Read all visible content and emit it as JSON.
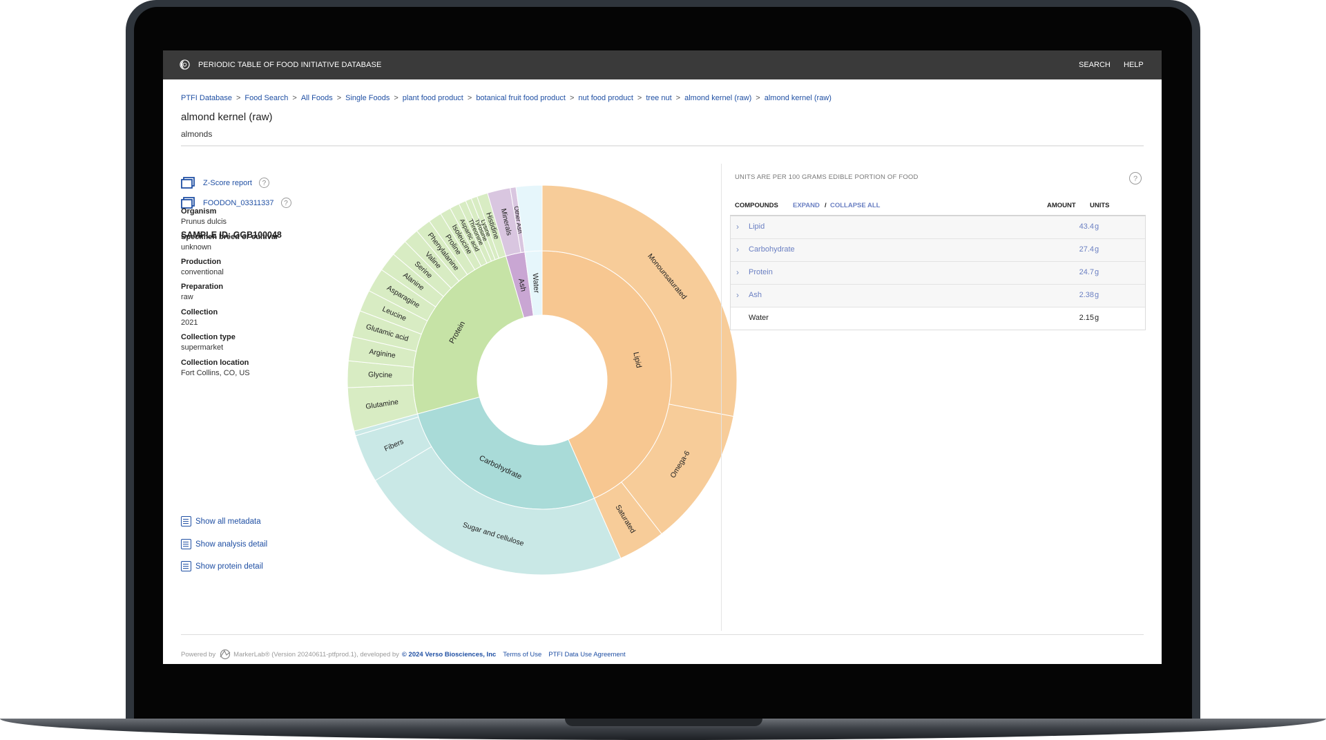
{
  "app": {
    "title": "PERIODIC TABLE OF FOOD INITIATIVE DATABASE"
  },
  "nav": {
    "search": "SEARCH",
    "help": "HELP"
  },
  "breadcrumbs": [
    "PTFI Database",
    "Food Search",
    "All Foods",
    "Single Foods",
    "plant food product",
    "botanical fruit food product",
    "nut food product",
    "tree nut",
    "almond kernel (raw)",
    "almond kernel (raw)"
  ],
  "breadcrumb_separator": ">",
  "food": {
    "title": "almond kernel (raw)",
    "subtitle": "almonds"
  },
  "links": {
    "zscore": "Z-Score report",
    "foodon": "FOODON_03311337"
  },
  "sample": {
    "id_label": "SAMPLE ID: GGB100048",
    "metadata": [
      {
        "key": "Organism",
        "value": "Prunus dulcis"
      },
      {
        "key": "Specimen breed or cultivar",
        "value": "unknown"
      },
      {
        "key": "Production",
        "value": "conventional"
      },
      {
        "key": "Preparation",
        "value": "raw"
      },
      {
        "key": "Collection",
        "value": "2021"
      },
      {
        "key": "Collection type",
        "value": "supermarket"
      },
      {
        "key": "Collection location",
        "value": "Fort Collins, CO, US"
      }
    ]
  },
  "detail_links": {
    "metadata": "Show all metadata",
    "analysis": "Show analysis detail",
    "protein": "Show protein detail"
  },
  "table": {
    "units_note": "UNITS ARE PER 100 GRAMS EDIBLE PORTION OF FOOD",
    "help": "?",
    "compounds_header": "COMPOUNDS",
    "expand": "EXPAND",
    "slash": "/",
    "collapse": "COLLAPSE ALL",
    "amount_header": "AMOUNT",
    "units_header": "UNITS",
    "rows": [
      {
        "name": "Lipid",
        "amount": "43.4",
        "unit": "g",
        "chevron": "›"
      },
      {
        "name": "Carbohydrate",
        "amount": "27.4",
        "unit": "g",
        "chevron": "›"
      },
      {
        "name": "Protein",
        "amount": "24.7",
        "unit": "g",
        "chevron": "›"
      },
      {
        "name": "Ash",
        "amount": "2.38",
        "unit": "g",
        "chevron": "›"
      },
      {
        "name": "Water",
        "amount": "2.15",
        "unit": "g",
        "chevron": ""
      }
    ]
  },
  "footer": {
    "powered": "Powered by",
    "version": "MarkerLab® (Version 20240611-ptfprod.1), developed by",
    "copyright": "© 2024 Verso Biosciences, Inc",
    "terms": "Terms of Use",
    "agreement": "PTFI Data Use Agreement"
  },
  "colors": {
    "lipid_inner": "#f7c791",
    "lipid_outer": "#f7cc99",
    "carb_inner": "#a9dbd8",
    "carb_outer": "#c9e8e6",
    "protein_inner": "#c6e3a6",
    "protein_outer": "#d8ecc3",
    "ash_inner": "#c9a6d3",
    "ash_outer": "#d9c6e0",
    "water": "#e6f6fb",
    "link": "#1f4fa3"
  },
  "chart_data": {
    "type": "sunburst",
    "inner": [
      {
        "name": "Lipid",
        "value": 43.4
      },
      {
        "name": "Carbohydrate",
        "value": 27.4
      },
      {
        "name": "Protein",
        "value": 24.7
      },
      {
        "name": "Ash",
        "value": 2.38
      },
      {
        "name": "Water",
        "value": 2.15
      }
    ],
    "outer": [
      {
        "parent": "Lipid",
        "name": "Monounsaturated",
        "value": 28.0
      },
      {
        "parent": "Lipid",
        "name": "Omega-6",
        "value": 11.5
      },
      {
        "parent": "Lipid",
        "name": "Saturated",
        "value": 3.9
      },
      {
        "parent": "Carbohydrate",
        "name": "Sugar and cellulose",
        "value": 23.0
      },
      {
        "parent": "Carbohydrate",
        "name": "Fibers",
        "value": 4.0
      },
      {
        "parent": "Carbohydrate",
        "name": "",
        "value": 0.4
      },
      {
        "parent": "Protein",
        "name": "Glutamine",
        "value": 3.6
      },
      {
        "parent": "Protein",
        "name": "Glycine",
        "value": 2.2
      },
      {
        "parent": "Protein",
        "name": "Arginine",
        "value": 2.0
      },
      {
        "parent": "Protein",
        "name": "Glutamic acid",
        "value": 2.2
      },
      {
        "parent": "Protein",
        "name": "Leucine",
        "value": 1.8
      },
      {
        "parent": "Protein",
        "name": "Asparagine",
        "value": 2.0
      },
      {
        "parent": "Protein",
        "name": "Alanine",
        "value": 1.6
      },
      {
        "parent": "Protein",
        "name": "Serine",
        "value": 1.4
      },
      {
        "parent": "Protein",
        "name": "Valine",
        "value": 1.3
      },
      {
        "parent": "Protein",
        "name": "Phenylalanine",
        "value": 1.3
      },
      {
        "parent": "Protein",
        "name": "Proline",
        "value": 1.1
      },
      {
        "parent": "Protein",
        "name": "Isoleucine",
        "value": 0.9
      },
      {
        "parent": "Protein",
        "name": "Aspartic acid",
        "value": 0.8
      },
      {
        "parent": "Protein",
        "name": "Threonine",
        "value": 0.6
      },
      {
        "parent": "Protein",
        "name": "Tyrosine",
        "value": 0.5
      },
      {
        "parent": "Protein",
        "name": "Lysine",
        "value": 0.5
      },
      {
        "parent": "Protein",
        "name": "Histidine",
        "value": 0.9
      },
      {
        "parent": "Ash",
        "name": "Minerals",
        "value": 1.9
      },
      {
        "parent": "Ash",
        "name": "Other Ash",
        "value": 0.48
      },
      {
        "parent": "Water",
        "name": "",
        "value": 2.15
      }
    ]
  }
}
